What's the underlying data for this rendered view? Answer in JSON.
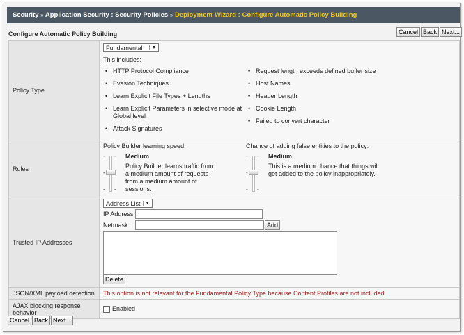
{
  "breadcrumb": {
    "items": [
      "Security",
      "Application Security : Security Policies"
    ],
    "current": "Deployment Wizard : Configure Automatic Policy Building",
    "separator": "»"
  },
  "page_title": "Configure Automatic Policy Building",
  "buttons": {
    "cancel": "Cancel",
    "back": "Back",
    "next": "Next..."
  },
  "policy_type": {
    "label": "Policy Type",
    "selected": "Fundamental",
    "includes_label": "This includes:",
    "left_items": [
      "HTTP Protocol Compliance",
      "Evasion Techniques",
      "Learn Explicit File Types + Lengths",
      "Learn Explicit Parameters in selective mode at Global level",
      "Attack Signatures"
    ],
    "right_items": [
      "Request length exceeds defined buffer size",
      "Host Names",
      "Header Length",
      "Cookie Length",
      "Failed to convert character"
    ]
  },
  "rules": {
    "label": "Rules",
    "speed": {
      "title": "Policy Builder learning speed:",
      "level": "Medium",
      "desc": "Policy Builder learns traffic from a medium amount of requests from a medium amount of sessions.",
      "value": 0.5
    },
    "false_entities": {
      "title": "Chance of adding false entities to the policy:",
      "level": "Medium",
      "desc": "This is a medium chance that things will get added to the policy inappropriately.",
      "value": 0.5
    }
  },
  "trusted_ip": {
    "label": "Trusted IP Addresses",
    "list_type": "Address List",
    "ip_label": "IP Address:",
    "netmask_label": "Netmask:",
    "ip_value": "",
    "netmask_value": "",
    "add": "Add",
    "delete": "Delete"
  },
  "json_xml": {
    "label": "JSON/XML payload detection",
    "message": "This option is not relevant for the Fundamental Policy Type because Content Profiles are not included."
  },
  "ajax": {
    "label": "AJAX blocking response behavior",
    "checkbox_label": "Enabled",
    "checked": false
  }
}
